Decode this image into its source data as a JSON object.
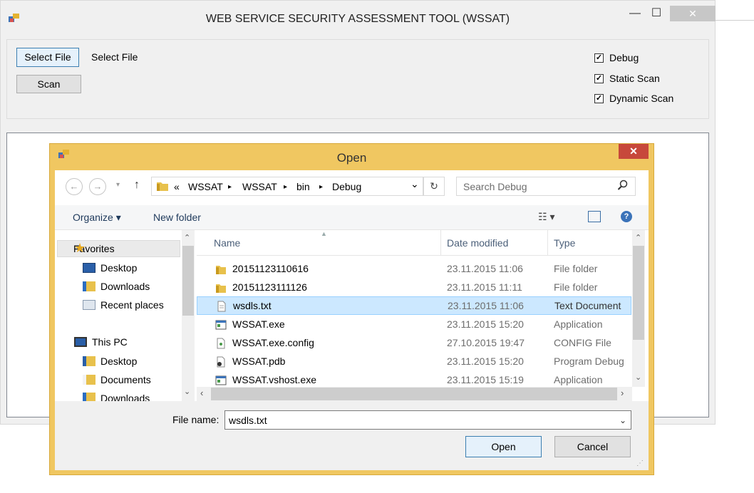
{
  "main_window": {
    "title": "WEB SERVICE SECURITY ASSESSMENT TOOL (WSSAT)",
    "minimize_glyph": "—",
    "maximize_glyph": "☐",
    "close_glyph": "✕",
    "select_file_button": "Select File",
    "select_file_label": "Select File",
    "scan_button": "Scan",
    "checkboxes": [
      {
        "label": "Debug",
        "checked": true
      },
      {
        "label": "Static Scan",
        "checked": true
      },
      {
        "label": "Dynamic Scan",
        "checked": true
      }
    ]
  },
  "dialog": {
    "title": "Open",
    "close_glyph": "✕",
    "address": {
      "overflow": "«",
      "crumbs": [
        "WSSAT",
        "WSSAT",
        "bin",
        "Debug"
      ],
      "separator": "▸",
      "dropdown_glyph": "⌄",
      "refresh_glyph": "↻"
    },
    "search": {
      "placeholder": "Search Debug"
    },
    "toolbar": {
      "organize": "Organize ▾",
      "new_folder": "New folder",
      "view_glyph": "☷ ▾",
      "help_glyph": "?"
    },
    "nav": {
      "favorites": "Favorites",
      "favorites_items": [
        "Desktop",
        "Downloads",
        "Recent places"
      ],
      "this_pc": "This PC",
      "pc_items": [
        "Desktop",
        "Documents",
        "Downloads"
      ]
    },
    "columns": {
      "name": "Name",
      "date": "Date modified",
      "type": "Type"
    },
    "files": [
      {
        "name": "20151123110616",
        "date": "23.11.2015 11:06",
        "type": "File folder",
        "icon": "folder-icon"
      },
      {
        "name": "20151123111126",
        "date": "23.11.2015 11:11",
        "type": "File folder",
        "icon": "folder-icon"
      },
      {
        "name": "wsdls.txt",
        "date": "23.11.2015 11:06",
        "type": "Text Document",
        "icon": "text-file-icon"
      },
      {
        "name": "WSSAT.exe",
        "date": "23.11.2015 15:20",
        "type": "Application",
        "icon": "app-icon"
      },
      {
        "name": "WSSAT.exe.config",
        "date": "27.10.2015 19:47",
        "type": "CONFIG File",
        "icon": "config-file-icon"
      },
      {
        "name": "WSSAT.pdb",
        "date": "23.11.2015 15:20",
        "type": "Program Debug",
        "icon": "pdb-file-icon"
      },
      {
        "name": "WSSAT.vshost.exe",
        "date": "23.11.2015 15:19",
        "type": "Application",
        "icon": "app-icon"
      }
    ],
    "file_name_label": "File name:",
    "file_name_value": "wsdls.txt",
    "open_button": "Open",
    "cancel_button": "Cancel"
  },
  "colors": {
    "dialog_frame": "#f0c761",
    "close_red": "#c7483b",
    "selection": "#cce8ff"
  }
}
